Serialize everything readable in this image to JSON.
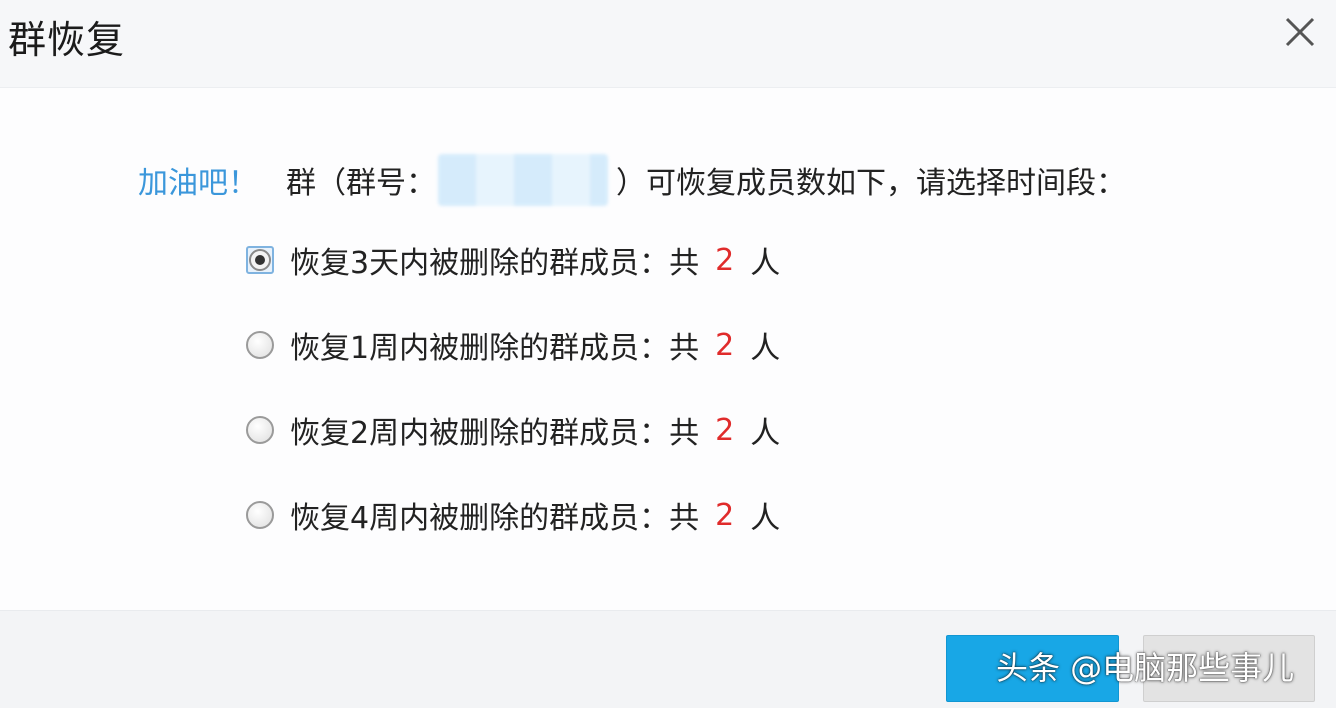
{
  "dialog": {
    "title": "群恢复",
    "close_icon": "close-icon"
  },
  "intro": {
    "cheer": "加油吧！",
    "before_id": "群（群号：",
    "after_id": "）可恢复成员数如下，请选择时间段："
  },
  "options": [
    {
      "label": "恢复3天内被删除的群成员：共",
      "count": "2",
      "unit": "人",
      "checked": true
    },
    {
      "label": "恢复1周内被删除的群成员：共",
      "count": "2",
      "unit": "人",
      "checked": false
    },
    {
      "label": "恢复2周内被删除的群成员：共",
      "count": "2",
      "unit": "人",
      "checked": false
    },
    {
      "label": "恢复4周内被删除的群成员：共",
      "count": "2",
      "unit": "人",
      "checked": false
    }
  ],
  "watermark": "头条 @电脑那些事儿",
  "colors": {
    "accent": "#3b97db",
    "count": "#e02b2b",
    "primary_button": "#18a7e6",
    "secondary_button": "#e3e3e3"
  }
}
